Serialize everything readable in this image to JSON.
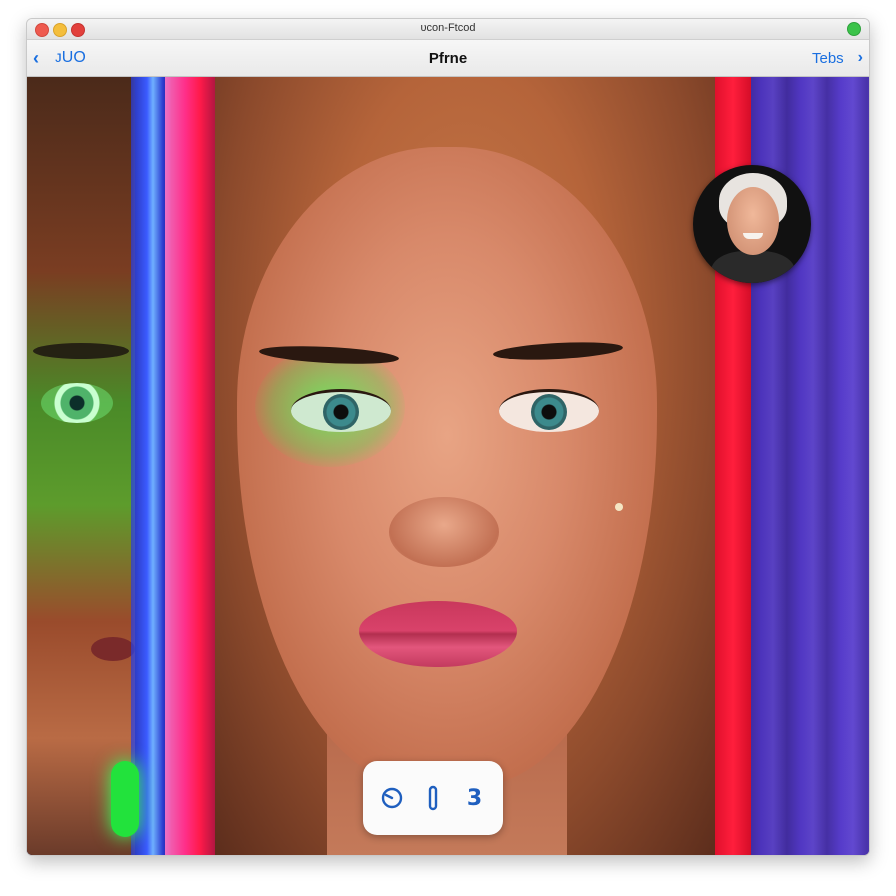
{
  "window": {
    "title": "ᴜcon-Ftcod"
  },
  "navbar": {
    "back_label": "ᴊUO",
    "title": "Pfrne",
    "right_label": "Tebs"
  },
  "controls": {
    "button_3_label": "3"
  },
  "icons": {
    "back": "chevron-left-icon",
    "forward": "chevron-right-icon",
    "timer": "timer-icon",
    "pause": "pause-bar-icon"
  },
  "colors": {
    "accent": "#1a6fe0",
    "close": "#ee5a4f",
    "minimize": "#f4be3c",
    "maximize": "#e2403c",
    "status": "#3bc34a"
  }
}
